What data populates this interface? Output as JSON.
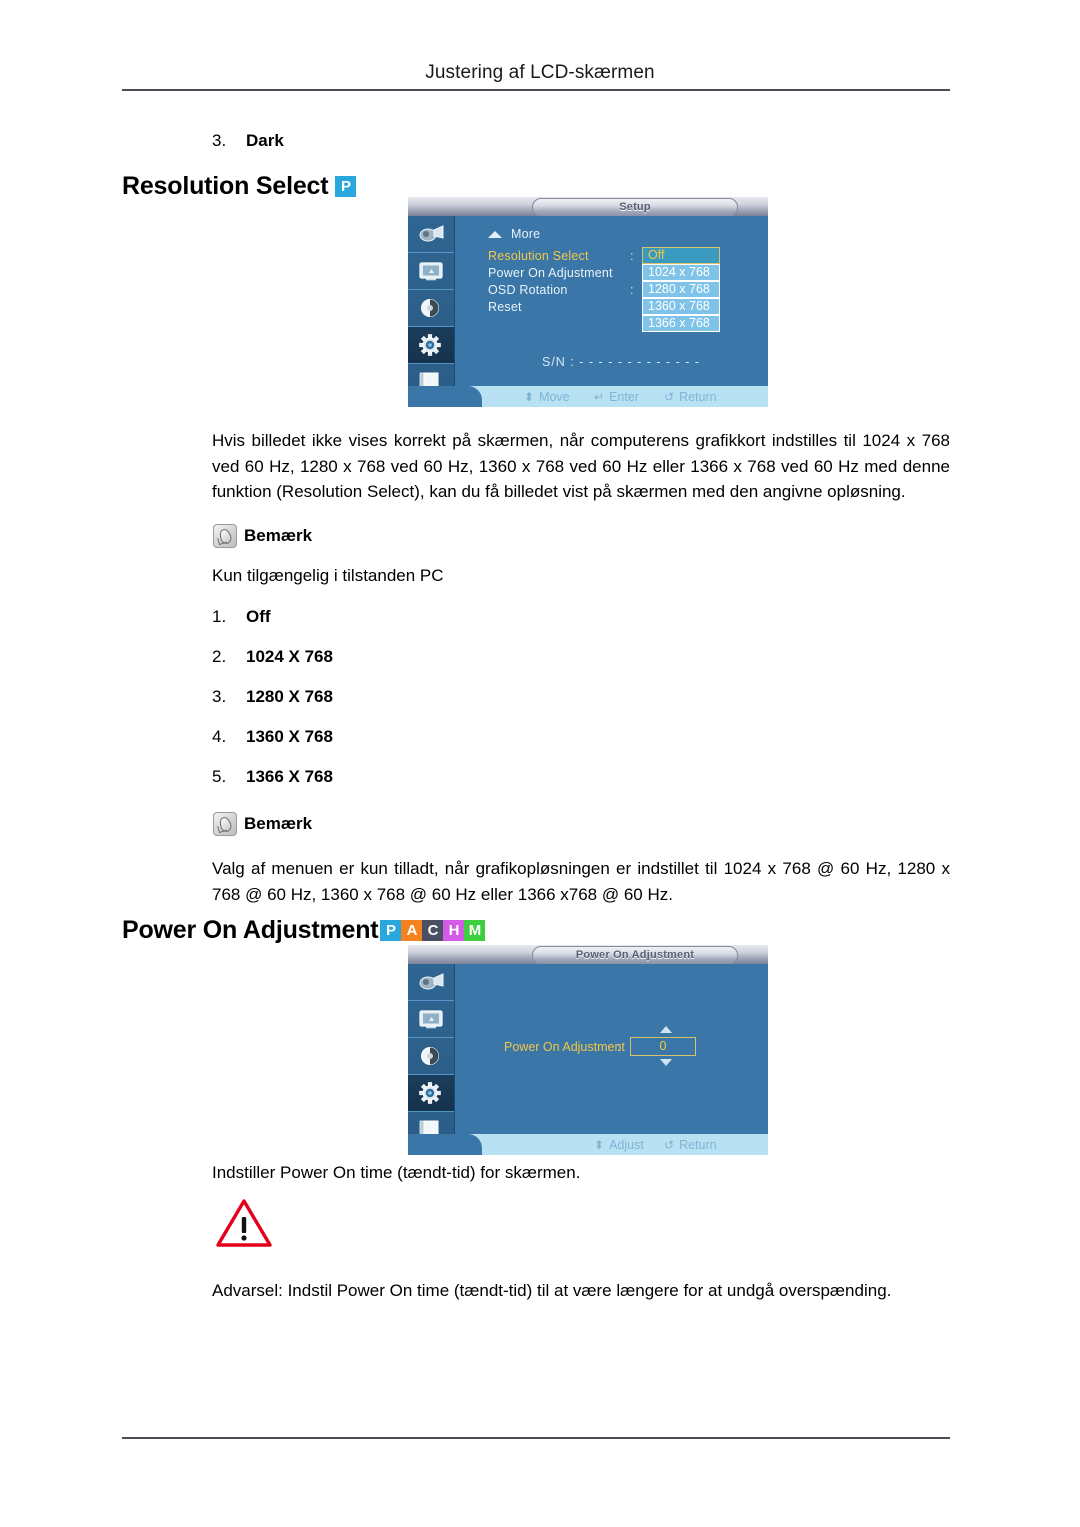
{
  "header": {
    "title": "Justering af LCD-skærmen"
  },
  "dark_item": {
    "number": "3.",
    "label": "Dark"
  },
  "section_resolution": {
    "title": "Resolution Select",
    "badges": [
      {
        "letter": "P",
        "color": "#29a8dd"
      }
    ],
    "paragraph": "Hvis billedet ikke vises korrekt på skærmen, når computerens grafikkort indstilles til 1024 x 768 ved 60 Hz, 1280 x 768 ved 60 Hz, 1360 x 768 ved 60 Hz eller 1366 x 768 ved 60 Hz med denne funktion (Resolution Select), kan du få billedet vist på skærmen med den angivne opløsning.",
    "note1_label": "Bemærk",
    "note1_text": "Kun tilgængelig i tilstanden PC",
    "options": [
      {
        "number": "1.",
        "label": "Off"
      },
      {
        "number": "2.",
        "label": "1024 X 768"
      },
      {
        "number": "3.",
        "label": "1280 X 768"
      },
      {
        "number": "4.",
        "label": "1360 X 768"
      },
      {
        "number": "5.",
        "label": "1366 X 768"
      }
    ],
    "note2_label": "Bemærk",
    "note2_text": "Valg af menuen er kun tilladt, når grafikopløsningen er indstillet til 1024 x 768 @ 60 Hz, 1280 x 768 @ 60 Hz, 1360 x 768 @ 60 Hz eller 1366 x768 @ 60 Hz."
  },
  "osd_setup": {
    "title": "Setup",
    "more_label": "More",
    "rows": [
      {
        "label": "Resolution Select",
        "colon": ":",
        "selected": true
      },
      {
        "label": "Power On Adjustment",
        "colon": "",
        "selected": false
      },
      {
        "label": "OSD Rotation",
        "colon": ":",
        "selected": false
      },
      {
        "label": "Reset",
        "colon": "",
        "selected": false
      }
    ],
    "dropdown": [
      "Off",
      "1024 x 768",
      "1280 x 768",
      "1360 x 768",
      "1366 x 768"
    ],
    "serial_label": "S/N :",
    "serial_value": "- - - - - - - - - - - - -",
    "footer": [
      {
        "icon": "updown-arrow-icon",
        "glyph": "⬍",
        "label": "Move"
      },
      {
        "icon": "enter-icon",
        "glyph": "↵",
        "label": "Enter"
      },
      {
        "icon": "return-icon",
        "glyph": "↺",
        "label": "Return"
      }
    ],
    "rail_icons": [
      "picture-icon",
      "screen-icon",
      "sound-icon",
      "setup-gear-icon",
      "multi-control-icon"
    ]
  },
  "section_power_on": {
    "title": "Power On Adjustment",
    "badges": [
      {
        "letter": "P",
        "color": "#29a8dd"
      },
      {
        "letter": "A",
        "color": "#f58220"
      },
      {
        "letter": "C",
        "color": "#4a4f63"
      },
      {
        "letter": "H",
        "color": "#d35be8"
      },
      {
        "letter": "M",
        "color": "#3ecf3e"
      }
    ],
    "description": "Indstiller Power On time (tændt-tid) for skærmen.",
    "warning_icon": "warning-triangle-icon",
    "warning_text": "Advarsel: Indstil Power On time (tændt-tid) til at være længere for at undgå overspænding."
  },
  "osd_power": {
    "title": "Power On Adjustment",
    "field_label": "Power On Adjustment",
    "field_colon": ":",
    "field_value": "0",
    "footer": [
      {
        "icon": "updown-arrow-icon",
        "glyph": "⬍",
        "label": "Adjust"
      },
      {
        "icon": "return-icon",
        "glyph": "↺",
        "label": "Return"
      }
    ],
    "rail_icons": [
      "picture-icon",
      "screen-icon",
      "sound-icon",
      "setup-gear-icon",
      "multi-control-icon"
    ]
  }
}
